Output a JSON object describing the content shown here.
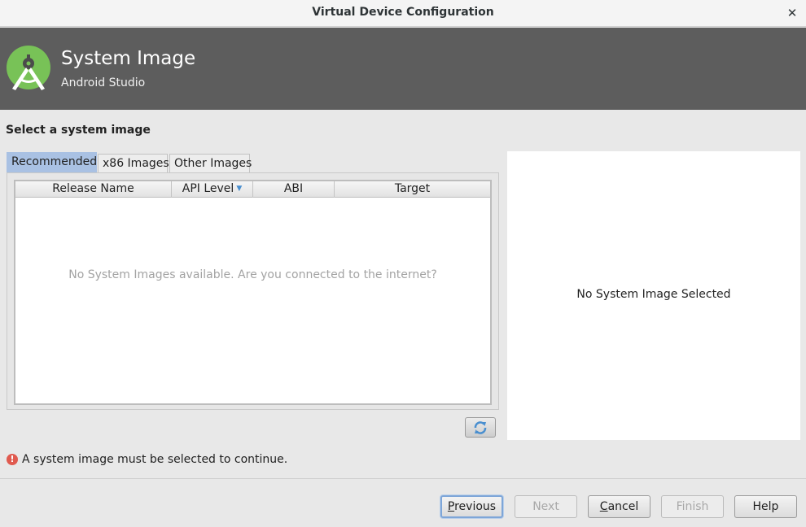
{
  "window": {
    "title": "Virtual Device Configuration",
    "close_icon": "close-icon"
  },
  "banner": {
    "title": "System Image",
    "subtitle": "Android Studio",
    "logo_icon": "android-studio-logo",
    "logo_color": "#78c257"
  },
  "section": {
    "title": "Select a system image"
  },
  "tabs": [
    {
      "label": "Recommended",
      "active": true
    },
    {
      "label": "x86 Images",
      "active": false
    },
    {
      "label": "Other Images",
      "active": false
    }
  ],
  "table": {
    "columns": [
      {
        "label": "Release Name",
        "sorted": false
      },
      {
        "label": "API Level",
        "sorted": true,
        "sort_direction": "descending"
      },
      {
        "label": "ABI",
        "sorted": false
      },
      {
        "label": "Target",
        "sorted": false
      }
    ],
    "rows": [],
    "empty_message": "No System Images available. Are you connected to the internet?"
  },
  "refresh_button": {
    "icon": "refresh-icon",
    "color": "#4a8fcf"
  },
  "details": {
    "message": "No System Image Selected"
  },
  "validation": {
    "icon": "error-icon",
    "message": "A system image must be selected to continue.",
    "color": "#e05a4f"
  },
  "footer": {
    "buttons": [
      {
        "label": "Previous",
        "mnemonic": "P",
        "enabled": true,
        "default": true
      },
      {
        "label": "Next",
        "mnemonic": "",
        "enabled": false,
        "default": false
      },
      {
        "label": "Cancel",
        "mnemonic": "C",
        "enabled": true,
        "default": false
      },
      {
        "label": "Finish",
        "mnemonic": "",
        "enabled": false,
        "default": false
      },
      {
        "label": "Help",
        "mnemonic": "",
        "enabled": true,
        "default": false
      }
    ]
  }
}
